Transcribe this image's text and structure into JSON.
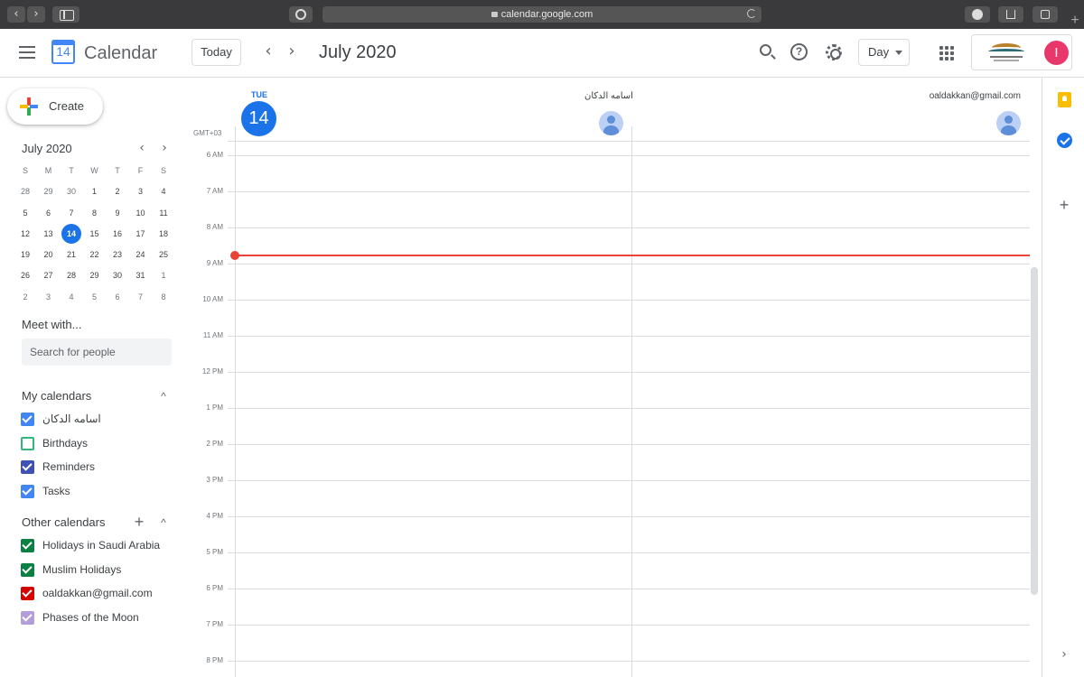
{
  "browser": {
    "back_glyph": "‹",
    "forward_glyph": "›",
    "url": "calendar.google.com",
    "new_tab_glyph": "+"
  },
  "header": {
    "app_title": "Calendar",
    "logo_day": "14",
    "today_label": "Today",
    "prev_glyph": "‹",
    "next_glyph": "›",
    "date_title": "July 2020",
    "help_glyph": "?",
    "view_label": "Day",
    "avatar_initial": "I"
  },
  "sidebar": {
    "create_label": "Create",
    "mini_calendar": {
      "title": "July 2020",
      "prev_glyph": "‹",
      "next_glyph": "›",
      "weekdays": [
        "S",
        "M",
        "T",
        "W",
        "T",
        "F",
        "S"
      ],
      "weeks": [
        [
          "28",
          "29",
          "30",
          "1",
          "2",
          "3",
          "4"
        ],
        [
          "5",
          "6",
          "7",
          "8",
          "9",
          "10",
          "11"
        ],
        [
          "12",
          "13",
          "14",
          "15",
          "16",
          "17",
          "18"
        ],
        [
          "19",
          "20",
          "21",
          "22",
          "23",
          "24",
          "25"
        ],
        [
          "26",
          "27",
          "28",
          "29",
          "30",
          "31",
          "1"
        ],
        [
          "2",
          "3",
          "4",
          "5",
          "6",
          "7",
          "8"
        ]
      ],
      "selected": "14"
    },
    "meet_with": {
      "title": "Meet with...",
      "placeholder": "Search for people"
    },
    "my_calendars": {
      "title": "My calendars",
      "items": [
        {
          "label": "اسامه الدكان",
          "color": "#4285f4",
          "checked": true
        },
        {
          "label": "Birthdays",
          "color": "#33b679",
          "checked": false
        },
        {
          "label": "Reminders",
          "color": "#3f51b5",
          "checked": true
        },
        {
          "label": "Tasks",
          "color": "#4285f4",
          "checked": true
        }
      ]
    },
    "other_calendars": {
      "title": "Other calendars",
      "items": [
        {
          "label": "Holidays in Saudi Arabia",
          "color": "#0b8043",
          "checked": true
        },
        {
          "label": "Muslim Holidays",
          "color": "#0b8043",
          "checked": true
        },
        {
          "label": "oaldakkan@gmail.com",
          "color": "#d50000",
          "checked": true
        },
        {
          "label": "Phases of the Moon",
          "color": "#b39ddb",
          "checked": true
        }
      ]
    }
  },
  "day_view": {
    "weekday": "TUE",
    "day": "14",
    "people": [
      "اسامه الدكان",
      "oaldakkan@gmail.com"
    ],
    "timezone": "GMT+03",
    "hours": [
      "6 AM",
      "7 AM",
      "8 AM",
      "9 AM",
      "10 AM",
      "11 AM",
      "12 PM",
      "1 PM",
      "2 PM",
      "3 PM",
      "4 PM",
      "5 PM",
      "6 PM",
      "7 PM",
      "8 PM"
    ]
  },
  "side_panel": {
    "add_glyph": "+",
    "expand_glyph": "›"
  },
  "colors": {
    "accent": "#1a73e8",
    "now_line": "#ea4335",
    "avatar": "#e8386b"
  }
}
